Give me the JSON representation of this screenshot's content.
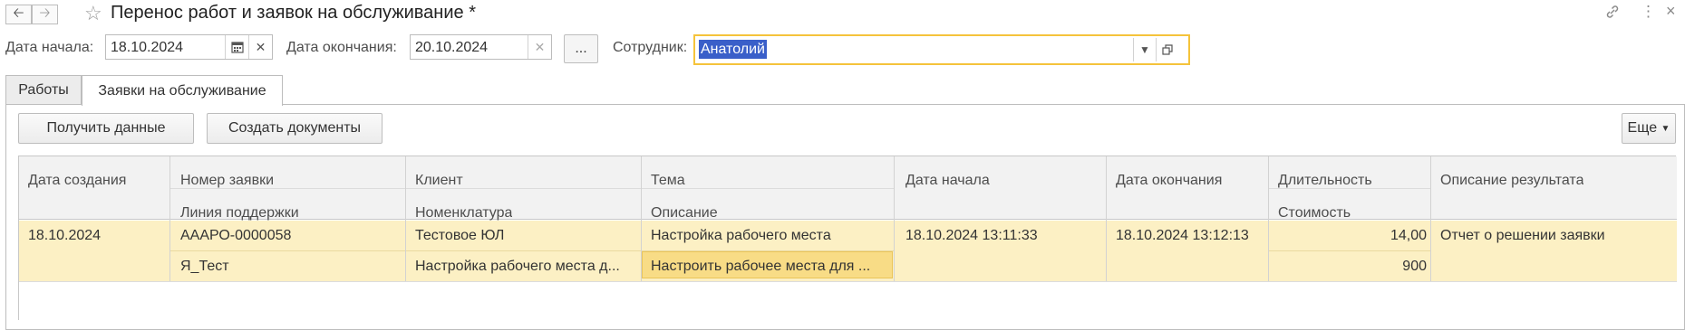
{
  "window": {
    "title": "Перенос работ и заявок на обслуживание *"
  },
  "filters": {
    "date_start_label": "Дата начала:",
    "date_start_value": "18.10.2024",
    "date_end_label": "Дата окончания:",
    "date_end_value": "20.10.2024",
    "dots_label": "...",
    "employee_label": "Сотрудник:",
    "employee_value": "Анатолий"
  },
  "tabs": [
    {
      "label": "Работы",
      "active": false
    },
    {
      "label": "Заявки на обслуживание",
      "active": true
    }
  ],
  "toolbar": {
    "get_data_label": "Получить данные",
    "create_docs_label": "Создать документы",
    "more_label": "Еще"
  },
  "table": {
    "headers": {
      "created": "Дата создания",
      "number": "Номер заявки",
      "support_line": "Линия поддержки",
      "client": "Клиент",
      "nomenclature": "Номенклатура",
      "topic": "Тема",
      "description": "Описание",
      "start": "Дата начала",
      "end": "Дата окончания",
      "duration": "Длительность",
      "cost": "Стоимость",
      "result": "Описание результата"
    },
    "rows": [
      {
        "created": "18.10.2024",
        "number": "АААРО-0000058",
        "support_line": "Я_Тест",
        "client": "Тестовое ЮЛ",
        "nomenclature": "Настройка рабочего места д...",
        "topic": "Настройка рабочего места",
        "description": "Настроить рабочее места для ...",
        "start": "18.10.2024 13:11:33",
        "end": "18.10.2024 13:12:13",
        "duration": "14,00",
        "cost": "900",
        "result": "Отчет о решении заявки"
      }
    ]
  },
  "colors": {
    "accent_focus": "#f5c33b",
    "row_highlight": "#fcf0c4",
    "current_cell": "#f8dc86",
    "selection": "#3a5fc9"
  },
  "icons": [
    "back-arrow-icon",
    "forward-arrow-icon",
    "star-icon",
    "link-icon",
    "more-vertical-icon",
    "close-icon",
    "calendar-icon",
    "clear-icon",
    "dropdown-arrow-icon",
    "open-icon"
  ]
}
